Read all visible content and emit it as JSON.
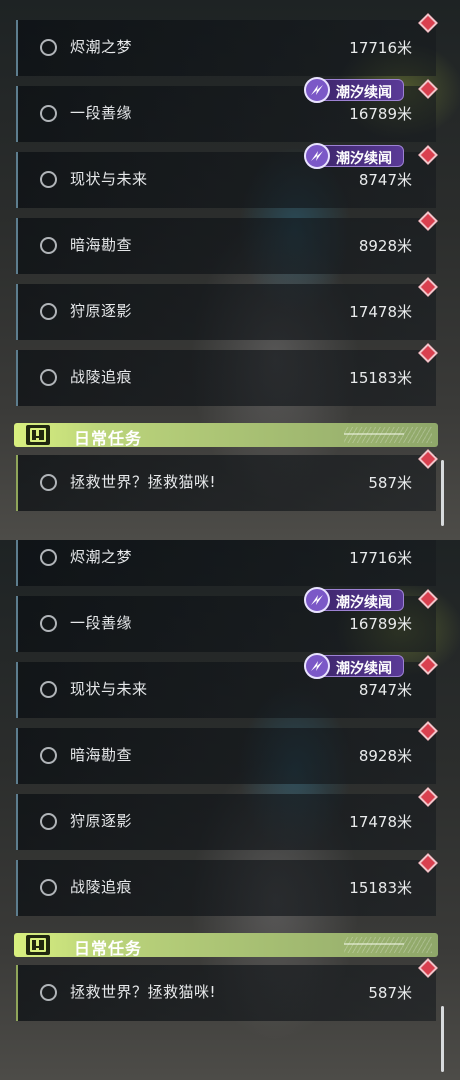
{
  "panels": [
    {
      "quests": [
        {
          "name": "烬潮之梦",
          "distance": "17716米",
          "badge": ""
        },
        {
          "name": "一段善缘",
          "distance": "16789米",
          "badge": "潮汐续闻"
        },
        {
          "name": "现状与未来",
          "distance": "8747米",
          "badge": "潮汐续闻"
        },
        {
          "name": "暗海勘查",
          "distance": "8928米",
          "badge": ""
        },
        {
          "name": "狩原逐影",
          "distance": "17478米",
          "badge": ""
        },
        {
          "name": "战陵追痕",
          "distance": "15183米",
          "badge": ""
        }
      ],
      "section": {
        "title": "日常任务"
      },
      "daily": [
        {
          "name": "拯救世界？拯救猫咪!",
          "distance": "587米"
        }
      ]
    },
    {
      "quests": [
        {
          "name": "烬潮之梦",
          "distance": "17716米",
          "badge": ""
        },
        {
          "name": "一段善缘",
          "distance": "16789米",
          "badge": "潮汐续闻"
        },
        {
          "name": "现状与未来",
          "distance": "8747米",
          "badge": "潮汐续闻"
        },
        {
          "name": "暗海勘查",
          "distance": "8928米",
          "badge": ""
        },
        {
          "name": "狩原逐影",
          "distance": "17478米",
          "badge": ""
        },
        {
          "name": "战陵追痕",
          "distance": "15183米",
          "badge": ""
        }
      ],
      "section": {
        "title": "日常任务"
      },
      "daily": [
        {
          "name": "拯救世界？拯救猫咪!",
          "distance": "587米"
        }
      ]
    }
  ],
  "icons": {
    "status": "circle-outline-icon",
    "tracking": "diamond-marker-icon",
    "badge_logo": "tide-logo-icon",
    "section": "exclamation-box-icon"
  },
  "colors": {
    "accent_green": "#d9f07f",
    "tracking_red": "#d9404f",
    "badge_purple": "#5a3a97",
    "quest_border": "#5d7d8e"
  }
}
